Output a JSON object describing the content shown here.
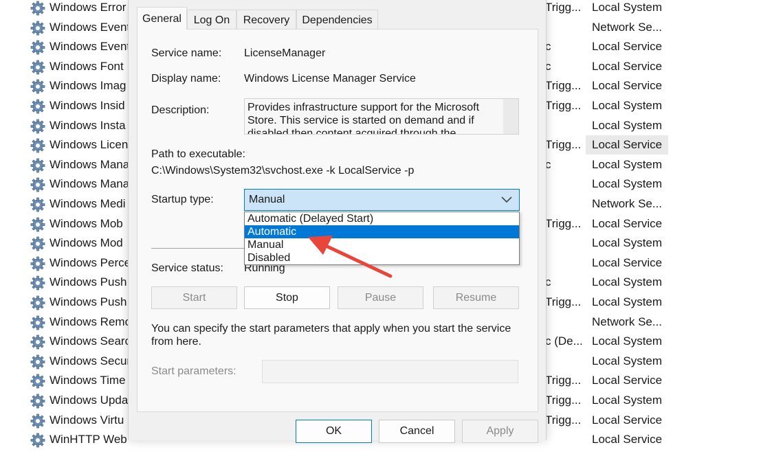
{
  "background_list": {
    "rows": [
      {
        "name": "Windows Error",
        "startup": "Trigg...",
        "logon": "Local System"
      },
      {
        "name": "Windows Event",
        "startup": "",
        "logon": "Network Se..."
      },
      {
        "name": "Windows Event",
        "startup": "c",
        "logon": "Local Service"
      },
      {
        "name": "Windows Font",
        "startup": "c",
        "logon": "Local Service"
      },
      {
        "name": "Windows Imag",
        "startup": "Trigg...",
        "logon": "Local Service"
      },
      {
        "name": "Windows Insid",
        "startup": "Trigg...",
        "logon": "Local System"
      },
      {
        "name": "Windows Insta",
        "startup": "",
        "logon": "Local System"
      },
      {
        "name": "Windows Licen",
        "startup": "Trigg...",
        "logon": "Local Service"
      },
      {
        "name": "Windows Mana",
        "startup": "c",
        "logon": "Local System"
      },
      {
        "name": "Windows Mana",
        "startup": "",
        "logon": "Local System"
      },
      {
        "name": "Windows Medi",
        "startup": "",
        "logon": "Network Se..."
      },
      {
        "name": "Windows Mob",
        "startup": "Trigg...",
        "logon": "Local Service"
      },
      {
        "name": "Windows Mod",
        "startup": "",
        "logon": "Local System"
      },
      {
        "name": "Windows Perce",
        "startup": "",
        "logon": "Local Service"
      },
      {
        "name": "Windows Push",
        "startup": "c",
        "logon": "Local System"
      },
      {
        "name": "Windows Push",
        "startup": "Trigg...",
        "logon": "Local System"
      },
      {
        "name": "Windows Remo",
        "startup": "",
        "logon": "Network Se..."
      },
      {
        "name": "Windows Searc",
        "startup": "c (De...",
        "logon": "Local System"
      },
      {
        "name": "Windows Secur",
        "startup": "",
        "logon": "Local System"
      },
      {
        "name": "Windows Time",
        "startup": "Trigg...",
        "logon": "Local Service"
      },
      {
        "name": "Windows Upda",
        "startup": "Trigg...",
        "logon": "Local System"
      },
      {
        "name": "Windows Virtu",
        "startup": "Trigg...",
        "logon": "Local Service"
      },
      {
        "name": "WinHTTP Web",
        "startup": "",
        "logon": "Local Service"
      }
    ]
  },
  "dialog": {
    "tabs": [
      "General",
      "Log On",
      "Recovery",
      "Dependencies"
    ],
    "service_name_label": "Service name:",
    "service_name": "LicenseManager",
    "display_name_label": "Display name:",
    "display_name": "Windows License Manager Service",
    "description_label": "Description:",
    "description": "Provides infrastructure support for the Microsoft Store.  This service is started on demand and if disabled then content acquired through the Microsoft",
    "path_label": "Path to executable:",
    "path": "C:\\Windows\\System32\\svchost.exe -k LocalService -p",
    "startup_type_label": "Startup type:",
    "startup_type_value": "Manual",
    "startup_options": [
      "Automatic (Delayed Start)",
      "Automatic",
      "Manual",
      "Disabled"
    ],
    "highlighted_option": "Automatic",
    "service_status_label": "Service status:",
    "service_status": "Running",
    "control_buttons": {
      "start": "Start",
      "stop": "Stop",
      "pause": "Pause",
      "resume": "Resume"
    },
    "params_hint": "You can specify the start parameters that apply when you start the service from here.",
    "start_params_label": "Start parameters:",
    "footer_buttons": {
      "ok": "OK",
      "cancel": "Cancel",
      "apply": "Apply"
    }
  },
  "colors": {
    "accent": "#0078d7",
    "annotation_arrow": "#e8463a",
    "select_bg": "#cce4f7"
  },
  "icons": {
    "service_row": "gear-icon",
    "dropdown": "chevron-down-icon"
  }
}
